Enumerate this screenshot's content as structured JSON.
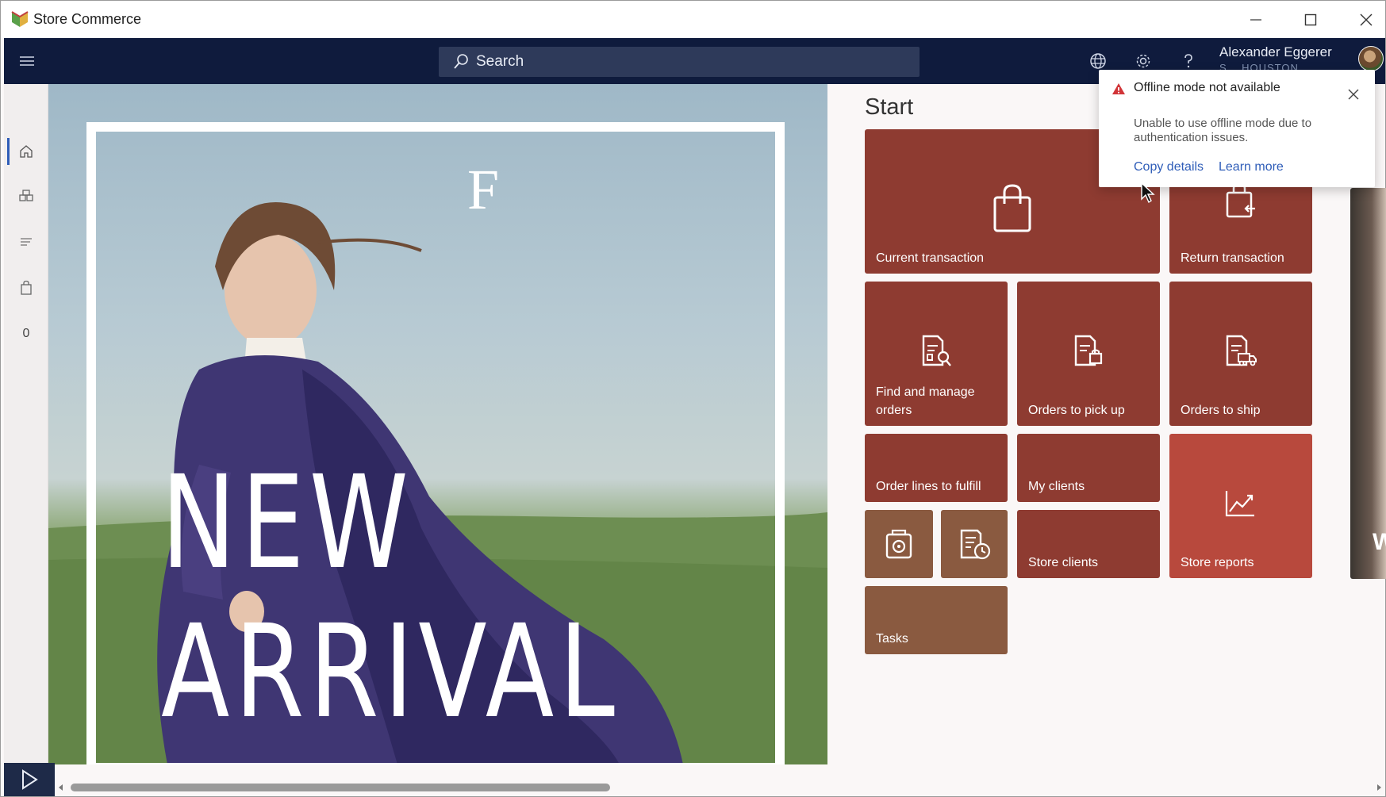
{
  "window": {
    "title": "Store Commerce",
    "controls": [
      "minimize-icon",
      "maximize-icon",
      "close-icon"
    ]
  },
  "navbar": {
    "search_placeholder": "Search",
    "icons": [
      "globe-icon",
      "gear-icon",
      "help-icon"
    ],
    "user_name": "Alexander Eggerer",
    "user_store": "S... HOUSTON ..."
  },
  "rail": {
    "items": [
      "home-icon",
      "products-icon",
      "list-icon",
      "shopping-bag-icon"
    ],
    "cart_count": "0"
  },
  "hero": {
    "logo": "F",
    "headline": "NEW ARRIVAL"
  },
  "start": {
    "title": "Start",
    "tiles": [
      {
        "label": "Current transaction",
        "icon": "shopping-bag-icon"
      },
      {
        "label": "Return transaction",
        "icon": "return-bag-icon"
      },
      {
        "label": "Find and manage orders",
        "icon": "find-order-icon"
      },
      {
        "label": "Orders to pick up",
        "icon": "pickup-order-icon"
      },
      {
        "label": "Orders to ship",
        "icon": "ship-order-icon"
      },
      {
        "label": "Order lines to fulfill",
        "icon": ""
      },
      {
        "label": "My clients",
        "icon": ""
      },
      {
        "label": "Store reports",
        "icon": "chart-icon"
      },
      {
        "label": "",
        "icon": "register-icon"
      },
      {
        "label": "",
        "icon": "timeclock-icon"
      },
      {
        "label": "Store clients",
        "icon": ""
      },
      {
        "label": "Tasks",
        "icon": ""
      }
    ]
  },
  "notification": {
    "title": "Offline mode not available",
    "message": "Unable to use offline mode due to authentication issues.",
    "copy_details": "Copy details",
    "learn_more": "Learn more"
  },
  "partial": {
    "side_letter": "W"
  },
  "colors": {
    "nav_bg": "#0f1b3d",
    "tile_dark": "#8e3b31",
    "tile_brown": "#8a5a40",
    "tile_bright": "#b8493d",
    "link": "#2f5db8",
    "warning": "#d13438"
  }
}
